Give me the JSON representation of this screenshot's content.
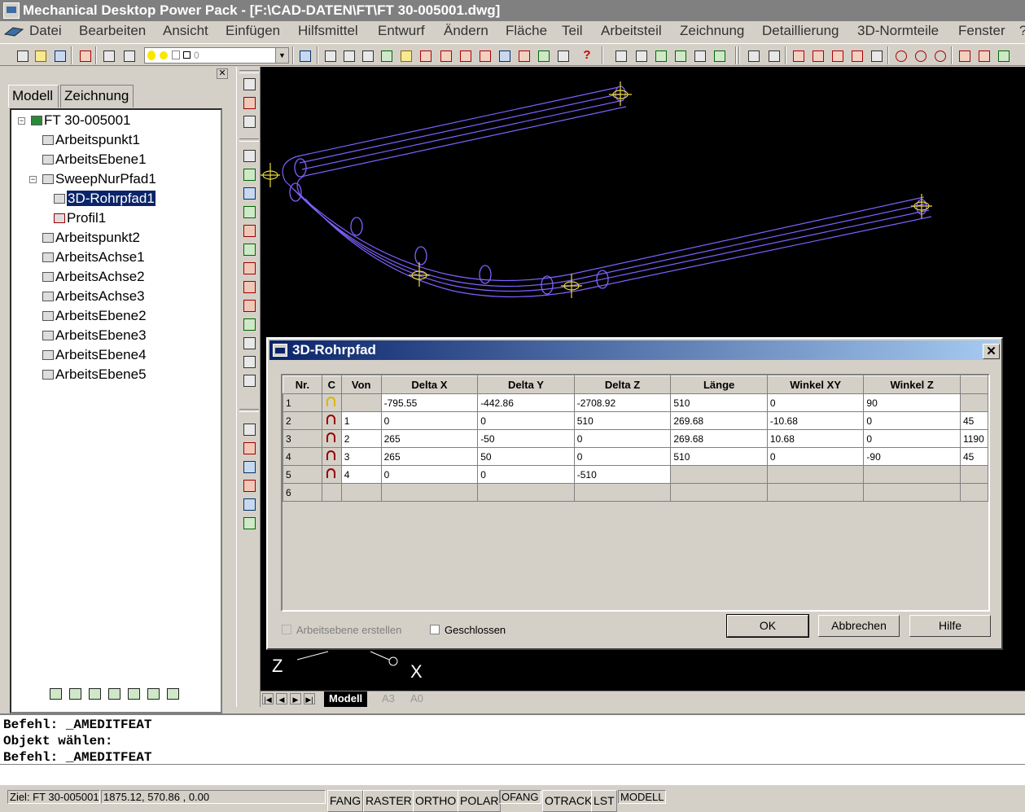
{
  "app": {
    "title": "Mechanical Desktop Power Pack - [F:\\CAD-DATEN\\FT\\FT 30-005001.dwg]"
  },
  "menu": [
    "Datei",
    "Bearbeiten",
    "Ansicht",
    "Einfügen",
    "Hilfsmittel",
    "Entwurf",
    "Ändern",
    "Fläche",
    "Teil",
    "Arbeitsteil",
    "Zeichnung",
    "Detaillierung",
    "3D-Normteile",
    "Fenster",
    "?"
  ],
  "layer_combo": {
    "value": "0"
  },
  "browser": {
    "tabs": [
      "Modell",
      "Zeichnung"
    ],
    "active_tab": "Modell",
    "tree": [
      {
        "label": "FT 30-005001",
        "level": 0,
        "expander": "−"
      },
      {
        "label": "Arbeitspunkt1",
        "level": 1
      },
      {
        "label": "ArbeitsEbene1",
        "level": 1
      },
      {
        "label": "SweepNurPfad1",
        "level": 1,
        "expander": "−"
      },
      {
        "label": "3D-Rohrpfad1",
        "level": 2,
        "selected": true
      },
      {
        "label": "Profil1",
        "level": 2
      },
      {
        "label": "Arbeitspunkt2",
        "level": 1
      },
      {
        "label": "ArbeitsAchse1",
        "level": 1
      },
      {
        "label": "ArbeitsAchse2",
        "level": 1
      },
      {
        "label": "ArbeitsAchse3",
        "level": 1
      },
      {
        "label": "ArbeitsEbene2",
        "level": 1
      },
      {
        "label": "ArbeitsEbene3",
        "level": 1
      },
      {
        "label": "ArbeitsEbene4",
        "level": 1
      },
      {
        "label": "ArbeitsEbene5",
        "level": 1
      }
    ]
  },
  "viewport": {
    "axis_labels": {
      "z": "Z",
      "x": "X"
    },
    "colors": {
      "pipe": "#8060ff",
      "marker": "#e8d840",
      "background": "#000000"
    }
  },
  "layout_tabs": [
    "Modell",
    "A3",
    "A0"
  ],
  "dialog": {
    "title": "3D-Rohrpfad",
    "close": "✕",
    "columns": [
      "Nr.",
      "C",
      "Von",
      "Delta X",
      "Delta Y",
      "Delta Z",
      "Länge",
      "Winkel XY",
      "Winkel Z",
      ""
    ],
    "rows": [
      {
        "nr": "1",
        "c": "yellow",
        "von": "",
        "dx": "-795.55",
        "dy": "-442.86",
        "dz": "-2708.92",
        "len": "510",
        "wxy": "0",
        "wz": "90",
        "extra": ""
      },
      {
        "nr": "2",
        "c": "red",
        "von": "1",
        "dx": "0",
        "dy": "0",
        "dz": "510",
        "len": "269.68",
        "wxy": "-10.68",
        "wz": "0",
        "extra": "45"
      },
      {
        "nr": "3",
        "c": "red",
        "von": "2",
        "dx": "265",
        "dy": "-50",
        "dz": "0",
        "len": "269.68",
        "wxy": "10.68",
        "wz": "0",
        "extra": "1190"
      },
      {
        "nr": "4",
        "c": "red",
        "von": "3",
        "dx": "265",
        "dy": "50",
        "dz": "0",
        "len": "510",
        "wxy": "0",
        "wz": "-90",
        "extra": "45"
      },
      {
        "nr": "5",
        "c": "red",
        "von": "4",
        "dx": "0",
        "dy": "0",
        "dz": "-510",
        "len": "",
        "wxy": "",
        "wz": "",
        "extra": ""
      },
      {
        "nr": "6",
        "c": "",
        "von": "",
        "dx": "",
        "dy": "",
        "dz": "",
        "len": "",
        "wxy": "",
        "wz": "",
        "extra": ""
      }
    ],
    "chk_workplane": "Arbeitsebene erstellen",
    "chk_closed": "Geschlossen",
    "btn_ok": "OK",
    "btn_cancel": "Abbrechen",
    "btn_help": "Hilfe"
  },
  "command": {
    "lines": [
      "Befehl: _AMEDITFEAT",
      "Objekt wählen:",
      "Befehl: _AMEDITFEAT"
    ]
  },
  "status": {
    "target": "Ziel: FT 30-005001",
    "coords": "1875.12, 570.86 , 0.00",
    "toggles": [
      "FANG",
      "RASTER",
      "ORTHO",
      "POLAR",
      "OFANG",
      "OTRACK",
      "LST",
      "MODELL"
    ]
  }
}
